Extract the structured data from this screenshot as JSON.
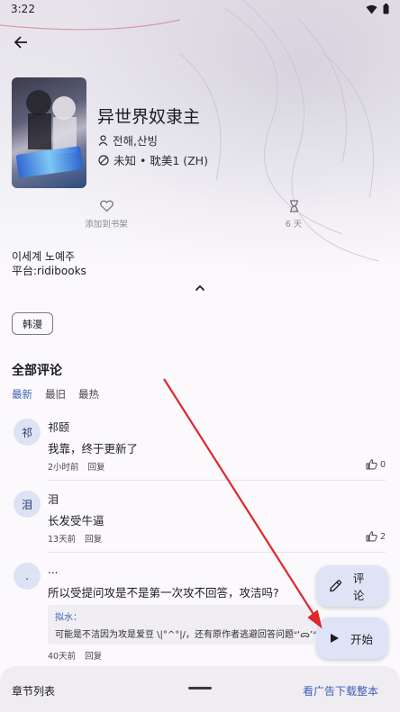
{
  "status_bar": {
    "time": "3:22"
  },
  "book": {
    "title": "异世界奴隶主",
    "authors": "전해,산빙",
    "status_line": "未知 • 耽美1 (ZH)",
    "alt_title": "이세계 노예주",
    "platform": "平台:ridibooks"
  },
  "actions": {
    "add_to_library": "添加到书架",
    "time_label": "6 天"
  },
  "tags": [
    "韩漫"
  ],
  "comments_section": {
    "title": "全部评论",
    "sort_tabs": [
      {
        "label": "最新",
        "active": true
      },
      {
        "label": "最旧",
        "active": false
      },
      {
        "label": "最热",
        "active": false
      }
    ],
    "items": [
      {
        "avatar": "祁",
        "name": "祁颐",
        "body": "我靠，终于更新了",
        "time": "2小时前",
        "reply": "回复",
        "likes": "0"
      },
      {
        "avatar": "泪",
        "name": "泪",
        "body": "长发受牛逼",
        "time": "13天前",
        "reply": "回复",
        "likes": "2"
      },
      {
        "avatar": ".",
        "name": "...",
        "body": "所以受提问攻是不是第一次攻不回答，攻洁吗?",
        "time": "40天前",
        "reply": "回复",
        "quoted_reply": {
          "author": "拟水：",
          "text": "可能是不洁因为攻是爱豆 \\|°^°|/，还有原作者逃避回答问题ᐡ‘ᯅ’ᐡ"
        }
      }
    ]
  },
  "fab": {
    "comment_label": "评论",
    "start_label": "开始"
  },
  "bottom_sheet": {
    "chapters_label": "章节列表",
    "download_label": "看广告下载整本"
  },
  "colors": {
    "accent": "#3f5fb9",
    "fab_bg": "#dee4f6",
    "annotation_arrow": "#e0262b"
  }
}
